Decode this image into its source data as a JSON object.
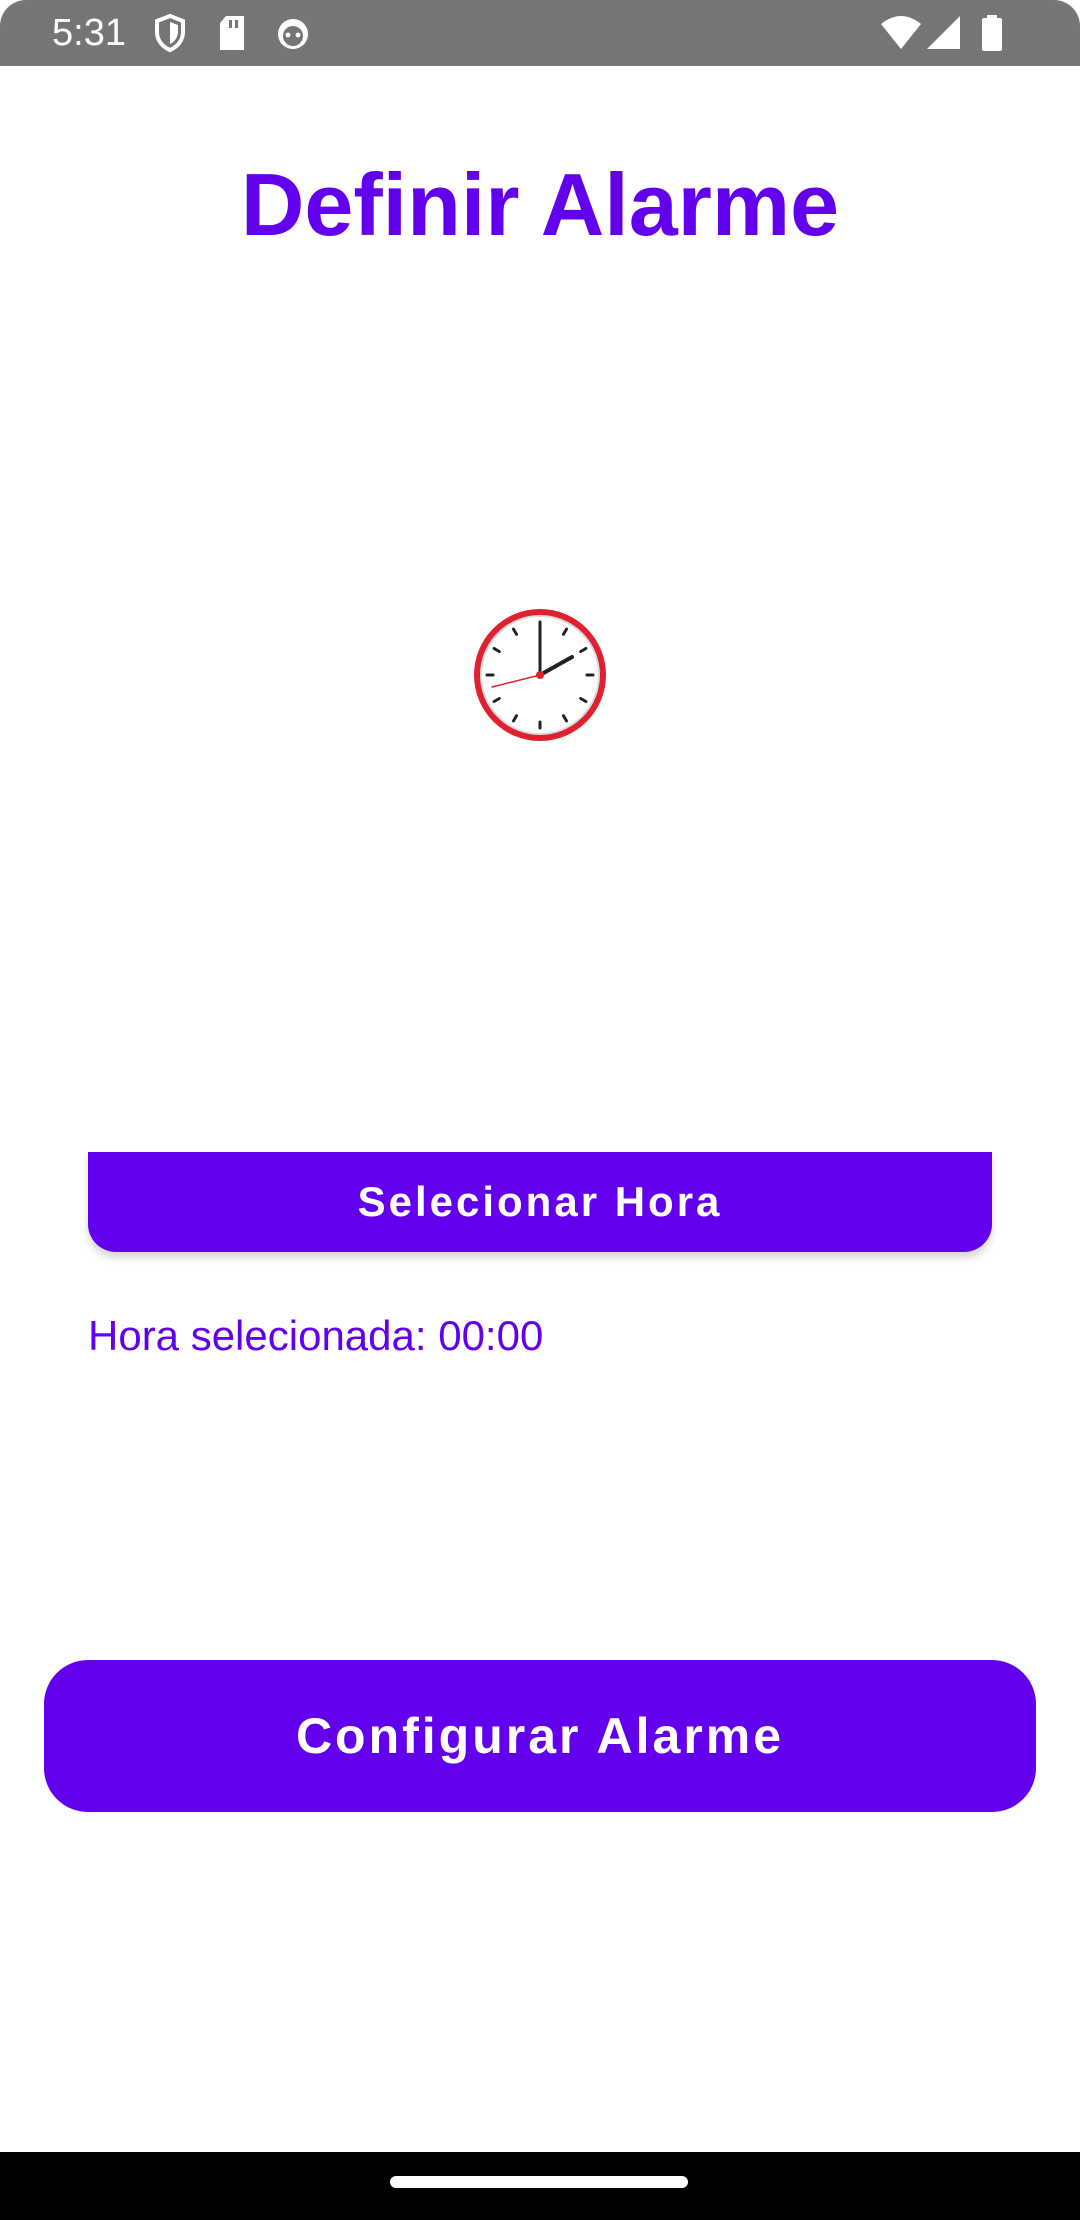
{
  "status_bar": {
    "time": "5:31",
    "icons": [
      "shield-icon",
      "sd-card-icon",
      "android-head-icon",
      "wifi-icon",
      "cellular-signal-icon",
      "battery-icon"
    ]
  },
  "screen": {
    "title": "Definir Alarme",
    "clock_icon": "clock-icon",
    "select_time_label": "Selecionar Hora",
    "selected_time_text": "Hora selecionada: 00:00",
    "configure_label": "Configurar Alarme"
  },
  "colors": {
    "accent": "#6200ee",
    "status_bar": "#757575",
    "clock_rim": "#e0202e"
  }
}
